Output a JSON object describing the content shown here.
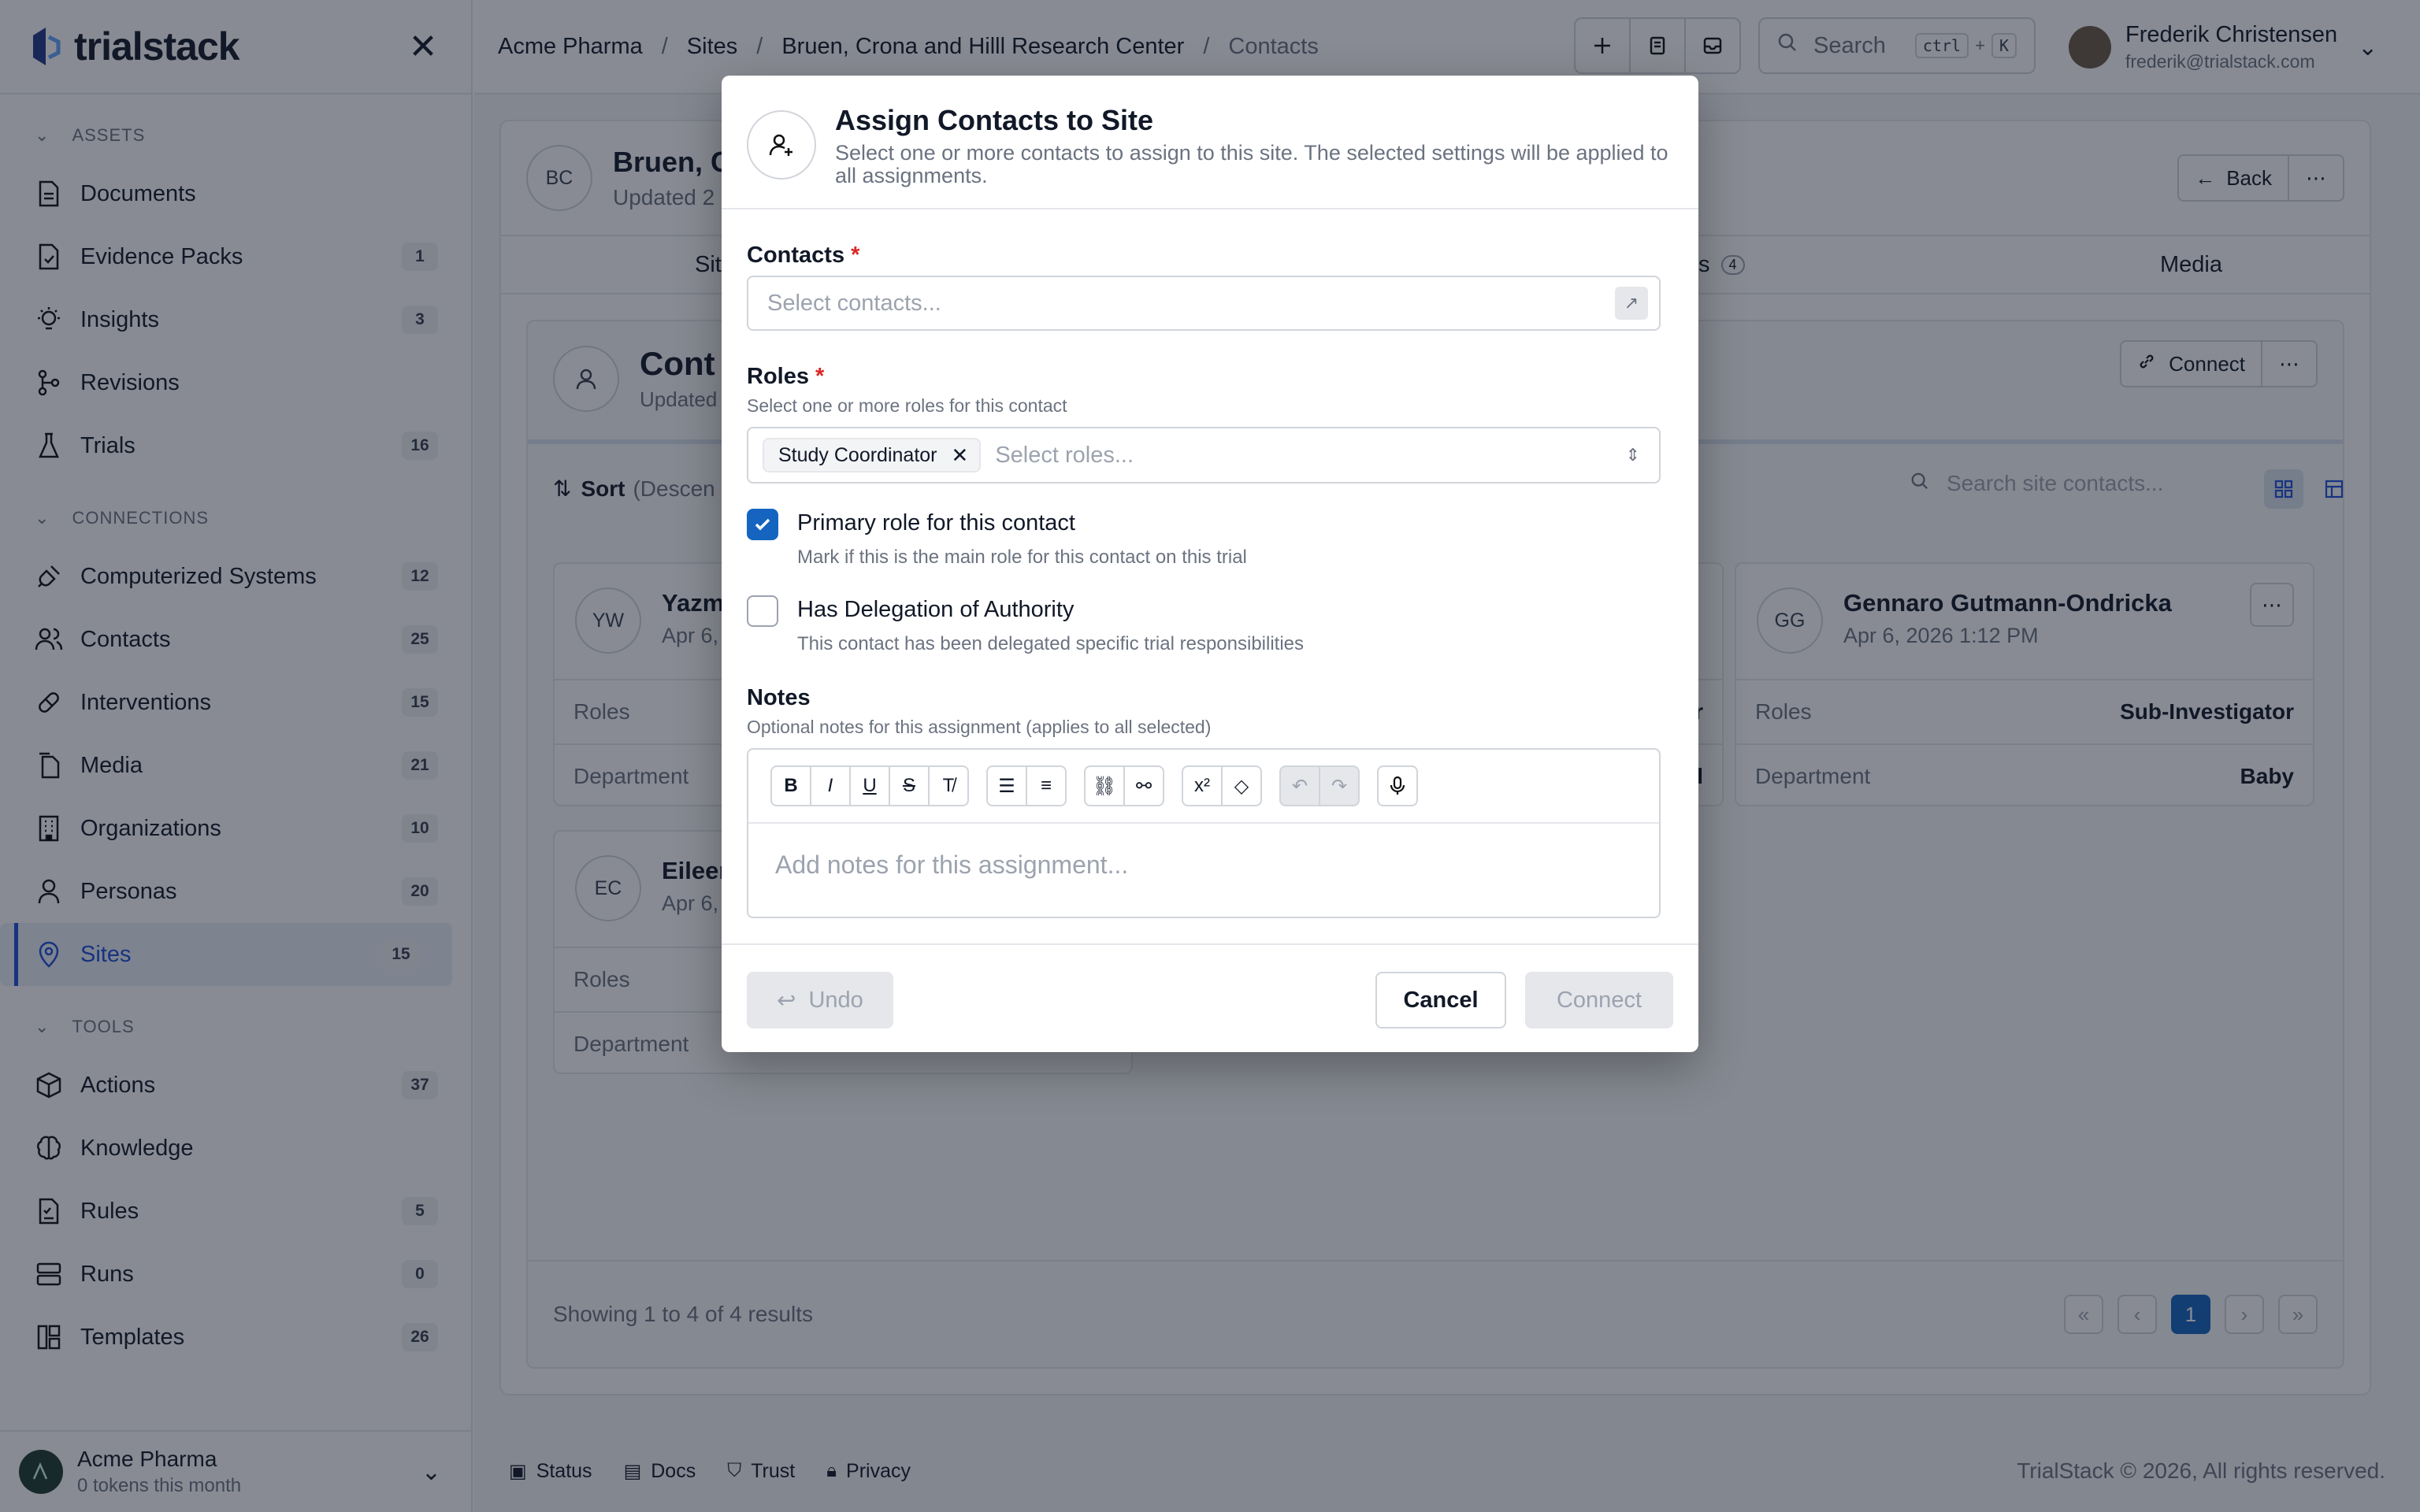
{
  "app": {
    "name": "trialstack"
  },
  "sidebar": {
    "sections": [
      {
        "label": "ASSETS",
        "items": [
          {
            "label": "Documents",
            "icon": "document-icon"
          },
          {
            "label": "Evidence Packs",
            "badge": "1"
          },
          {
            "label": "Insights",
            "badge": "3"
          },
          {
            "label": "Revisions"
          },
          {
            "label": "Trials",
            "badge": "16"
          }
        ]
      },
      {
        "label": "CONNECTIONS",
        "items": [
          {
            "label": "Computerized Systems",
            "badge": "12"
          },
          {
            "label": "Contacts",
            "badge": "25"
          },
          {
            "label": "Interventions",
            "badge": "15"
          },
          {
            "label": "Media",
            "badge": "21"
          },
          {
            "label": "Organizations",
            "badge": "10"
          },
          {
            "label": "Personas",
            "badge": "20"
          },
          {
            "label": "Sites",
            "badge": "15"
          }
        ]
      },
      {
        "label": "TOOLS",
        "items": [
          {
            "label": "Actions",
            "badge": "37"
          },
          {
            "label": "Knowledge"
          },
          {
            "label": "Rules",
            "badge": "5"
          },
          {
            "label": "Runs",
            "badge": "0"
          },
          {
            "label": "Templates",
            "badge": "26"
          }
        ]
      }
    ],
    "org": {
      "name": "Acme Pharma",
      "sub": "0 tokens this month"
    }
  },
  "topbar": {
    "breadcrumbs": [
      "Acme Pharma",
      "Sites",
      "Bruen, Crona and Hilll Research Center",
      "Contacts"
    ],
    "search_placeholder": "Search",
    "kbd_ctrl": "ctrl",
    "kbd_plus": "+",
    "kbd_k": "K",
    "user_name": "Frederik Christensen",
    "user_email": "frederik@trialstack.com"
  },
  "site": {
    "initials": "BC",
    "name": "Bruen, C",
    "updated": "Updated 2",
    "back_label": "Back",
    "tab_site": "Sit",
    "tab_contacts_suffix": "s",
    "tab_contacts_count": "4",
    "tab_media": "Media"
  },
  "contacts_panel": {
    "title": "Cont",
    "updated": "Updated",
    "connect_label": "Connect",
    "sort_label": "Sort",
    "sort_dir": "(Descen",
    "search_placeholder": "Search site contacts...",
    "cards": [
      {
        "initials": "YW",
        "name": "Yazm",
        "date": "Apr 6,",
        "roles_label": "Roles",
        "dept_label": "Department"
      },
      {
        "roles_value": "or",
        "dept_value": "al"
      },
      {
        "initials": "GG",
        "name": "Gennaro Gutmann-Ondricka",
        "date": "Apr 6, 2026 1:12 PM",
        "roles_label": "Roles",
        "roles_value": "Sub-Investigator",
        "dept_label": "Department",
        "dept_value": "Baby"
      },
      {
        "initials": "EC",
        "name": "Eileer",
        "date": "Apr 6,",
        "roles_label": "Roles",
        "dept_label": "Department"
      }
    ],
    "showing": "Showing 1 to 4 of 4 results",
    "page": "1"
  },
  "footer": {
    "links": [
      "Status",
      "Docs",
      "Trust",
      "Privacy"
    ],
    "copyright": "TrialStack © 2026, All rights reserved."
  },
  "modal": {
    "title": "Assign Contacts to Site",
    "description": "Select one or more contacts to assign to this site. The selected settings will be applied to all assignments.",
    "contacts_label": "Contacts",
    "contacts_placeholder": "Select contacts...",
    "roles_label": "Roles",
    "roles_help": "Select one or more roles for this contact",
    "roles_chip": "Study Coordinator",
    "roles_placeholder": "Select roles...",
    "required_mark": "*",
    "primary_label": "Primary role for this contact",
    "primary_help": "Mark if this is the main role for this contact on this trial",
    "primary_checked": true,
    "delegation_label": "Has Delegation of Authority",
    "delegation_help": "This contact has been delegated specific trial responsibilities",
    "delegation_checked": false,
    "notes_label": "Notes",
    "notes_help": "Optional notes for this assignment (applies to all selected)",
    "notes_placeholder": "Add notes for this assignment...",
    "undo_label": "Undo",
    "cancel_label": "Cancel",
    "connect_label": "Connect"
  },
  "colors": {
    "accent": "#1d4ed8",
    "checkbox": "#1565c0",
    "required": "#dc2626"
  }
}
